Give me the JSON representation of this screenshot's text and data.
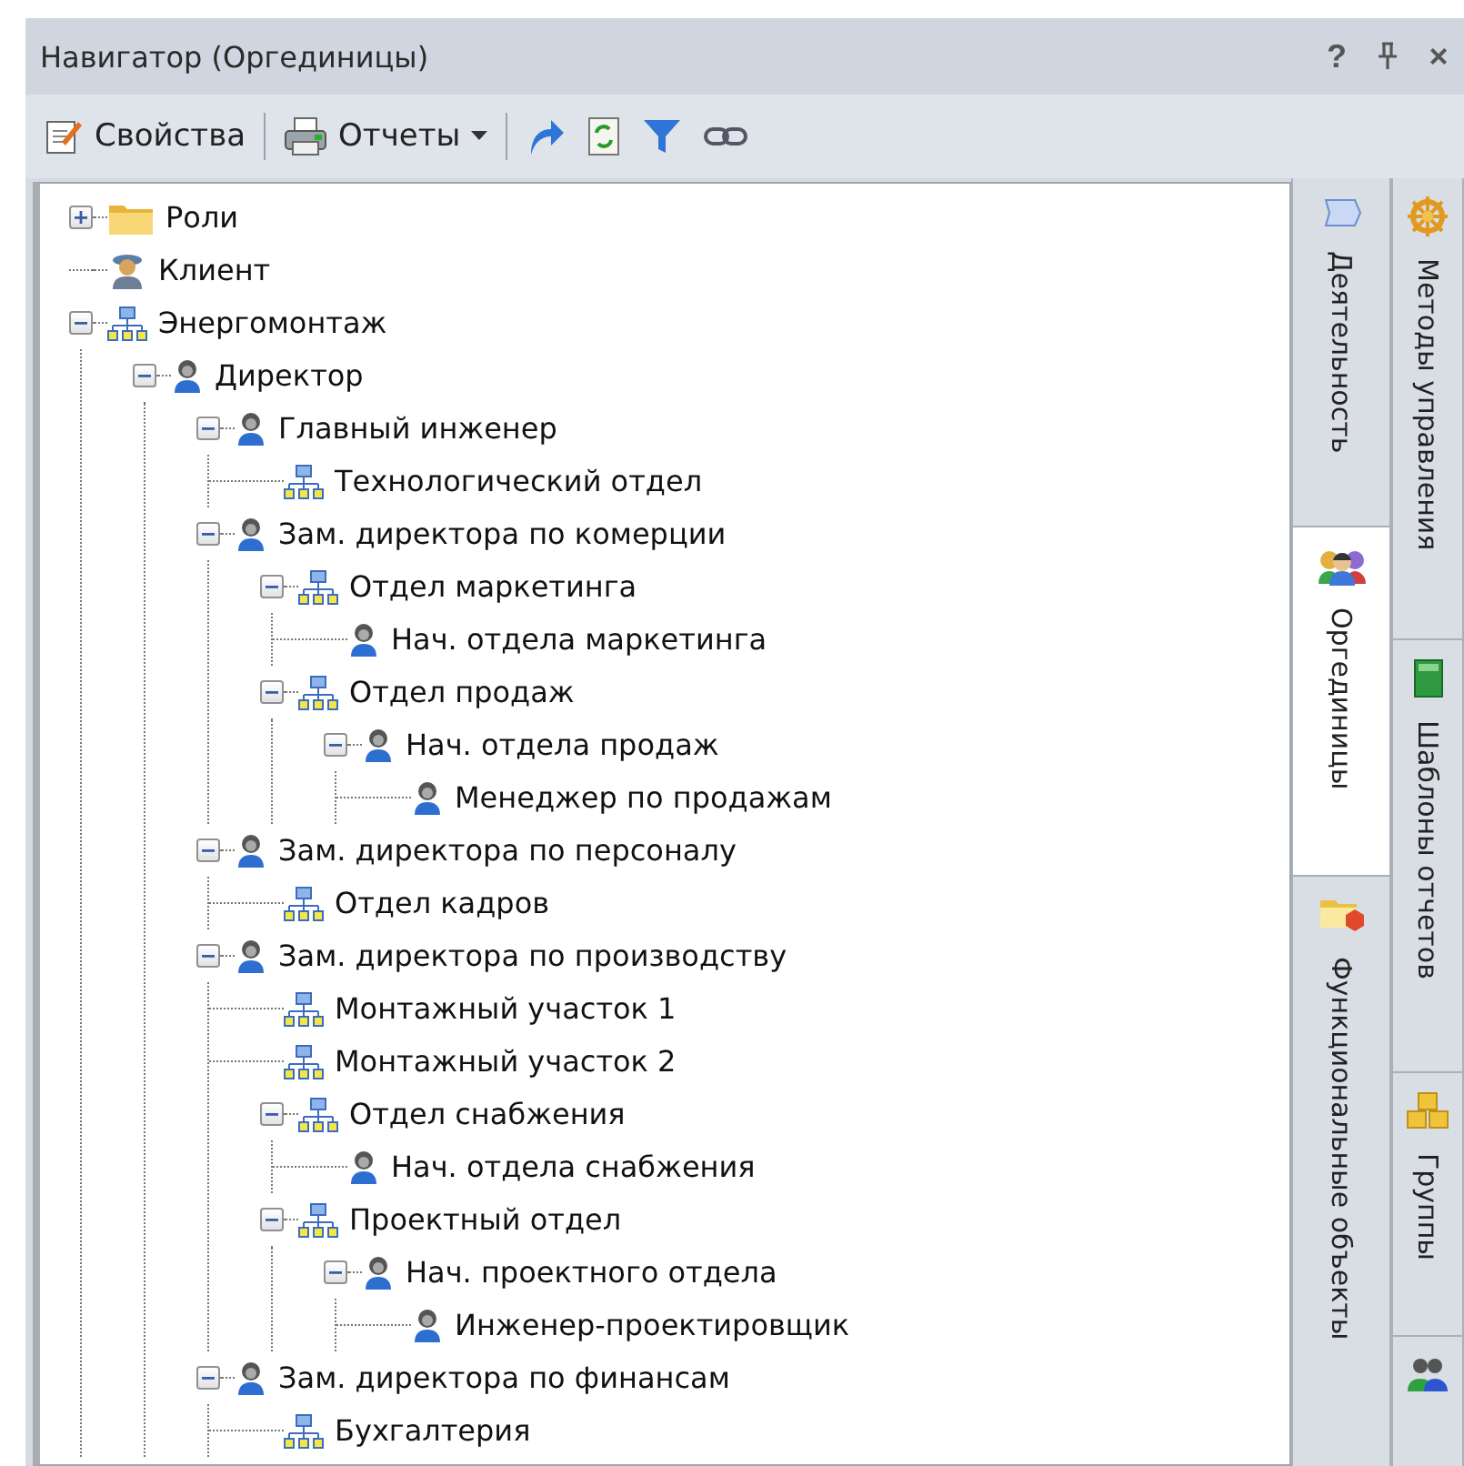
{
  "window": {
    "title": "Навигатор (Оргединицы)",
    "help": "?",
    "close": "×"
  },
  "toolbar": {
    "properties": "Свойства",
    "reports": "Отчеты"
  },
  "tree": [
    {
      "label": "Роли",
      "kind": "folder",
      "expanded": false
    },
    {
      "label": "Клиент",
      "kind": "client"
    },
    {
      "label": "Энергомонтаж",
      "kind": "org",
      "expanded": true,
      "children": [
        {
          "label": "Директор",
          "kind": "person",
          "expanded": true,
          "children": [
            {
              "label": "Главный инженер",
              "kind": "person",
              "expanded": true,
              "children": [
                {
                  "label": "Технологический отдел",
                  "kind": "org"
                }
              ]
            },
            {
              "label": "Зам. директора по комерции",
              "kind": "person",
              "expanded": true,
              "children": [
                {
                  "label": "Отдел маркетинга",
                  "kind": "org",
                  "expanded": true,
                  "children": [
                    {
                      "label": "Нач. отдела маркетинга",
                      "kind": "person"
                    }
                  ]
                },
                {
                  "label": "Отдел продаж",
                  "kind": "org",
                  "expanded": true,
                  "children": [
                    {
                      "label": "Нач. отдела продаж",
                      "kind": "person",
                      "expanded": true,
                      "children": [
                        {
                          "label": "Менеджер по продажам",
                          "kind": "person"
                        }
                      ]
                    }
                  ]
                }
              ]
            },
            {
              "label": "Зам. директора по персоналу",
              "kind": "person",
              "expanded": true,
              "children": [
                {
                  "label": "Отдел кадров",
                  "kind": "org"
                }
              ]
            },
            {
              "label": "Зам. директора по производству",
              "kind": "person",
              "expanded": true,
              "children": [
                {
                  "label": "Монтажный участок 1",
                  "kind": "org"
                },
                {
                  "label": "Монтажный участок 2",
                  "kind": "org"
                },
                {
                  "label": "Отдел снабжения",
                  "kind": "org",
                  "expanded": true,
                  "children": [
                    {
                      "label": "Нач. отдела снабжения",
                      "kind": "person"
                    }
                  ]
                },
                {
                  "label": "Проектный отдел",
                  "kind": "org",
                  "expanded": true,
                  "children": [
                    {
                      "label": "Нач. проектного отдела",
                      "kind": "person",
                      "expanded": true,
                      "children": [
                        {
                          "label": "Инженер-проектировщик",
                          "kind": "person"
                        }
                      ]
                    }
                  ]
                }
              ]
            },
            {
              "label": "Зам. директора по финансам",
              "kind": "person",
              "expanded": true,
              "children": [
                {
                  "label": "Бухгалтерия",
                  "kind": "org"
                }
              ]
            }
          ]
        }
      ]
    }
  ],
  "tabs_inner": [
    {
      "label": "Деятельность",
      "kind": "activity",
      "selected": false
    },
    {
      "label": "Оргединицы",
      "kind": "people",
      "selected": true
    },
    {
      "label": "Функциональные объекты",
      "kind": "objects",
      "selected": false
    }
  ],
  "tabs_outer": [
    {
      "label": "Методы управления",
      "kind": "wheel",
      "selected": false
    },
    {
      "label": "Шаблоны отчетов",
      "kind": "book",
      "selected": false
    },
    {
      "label": "Группы",
      "kind": "cubes",
      "selected": false
    },
    {
      "kind": "users",
      "selected": false
    }
  ]
}
